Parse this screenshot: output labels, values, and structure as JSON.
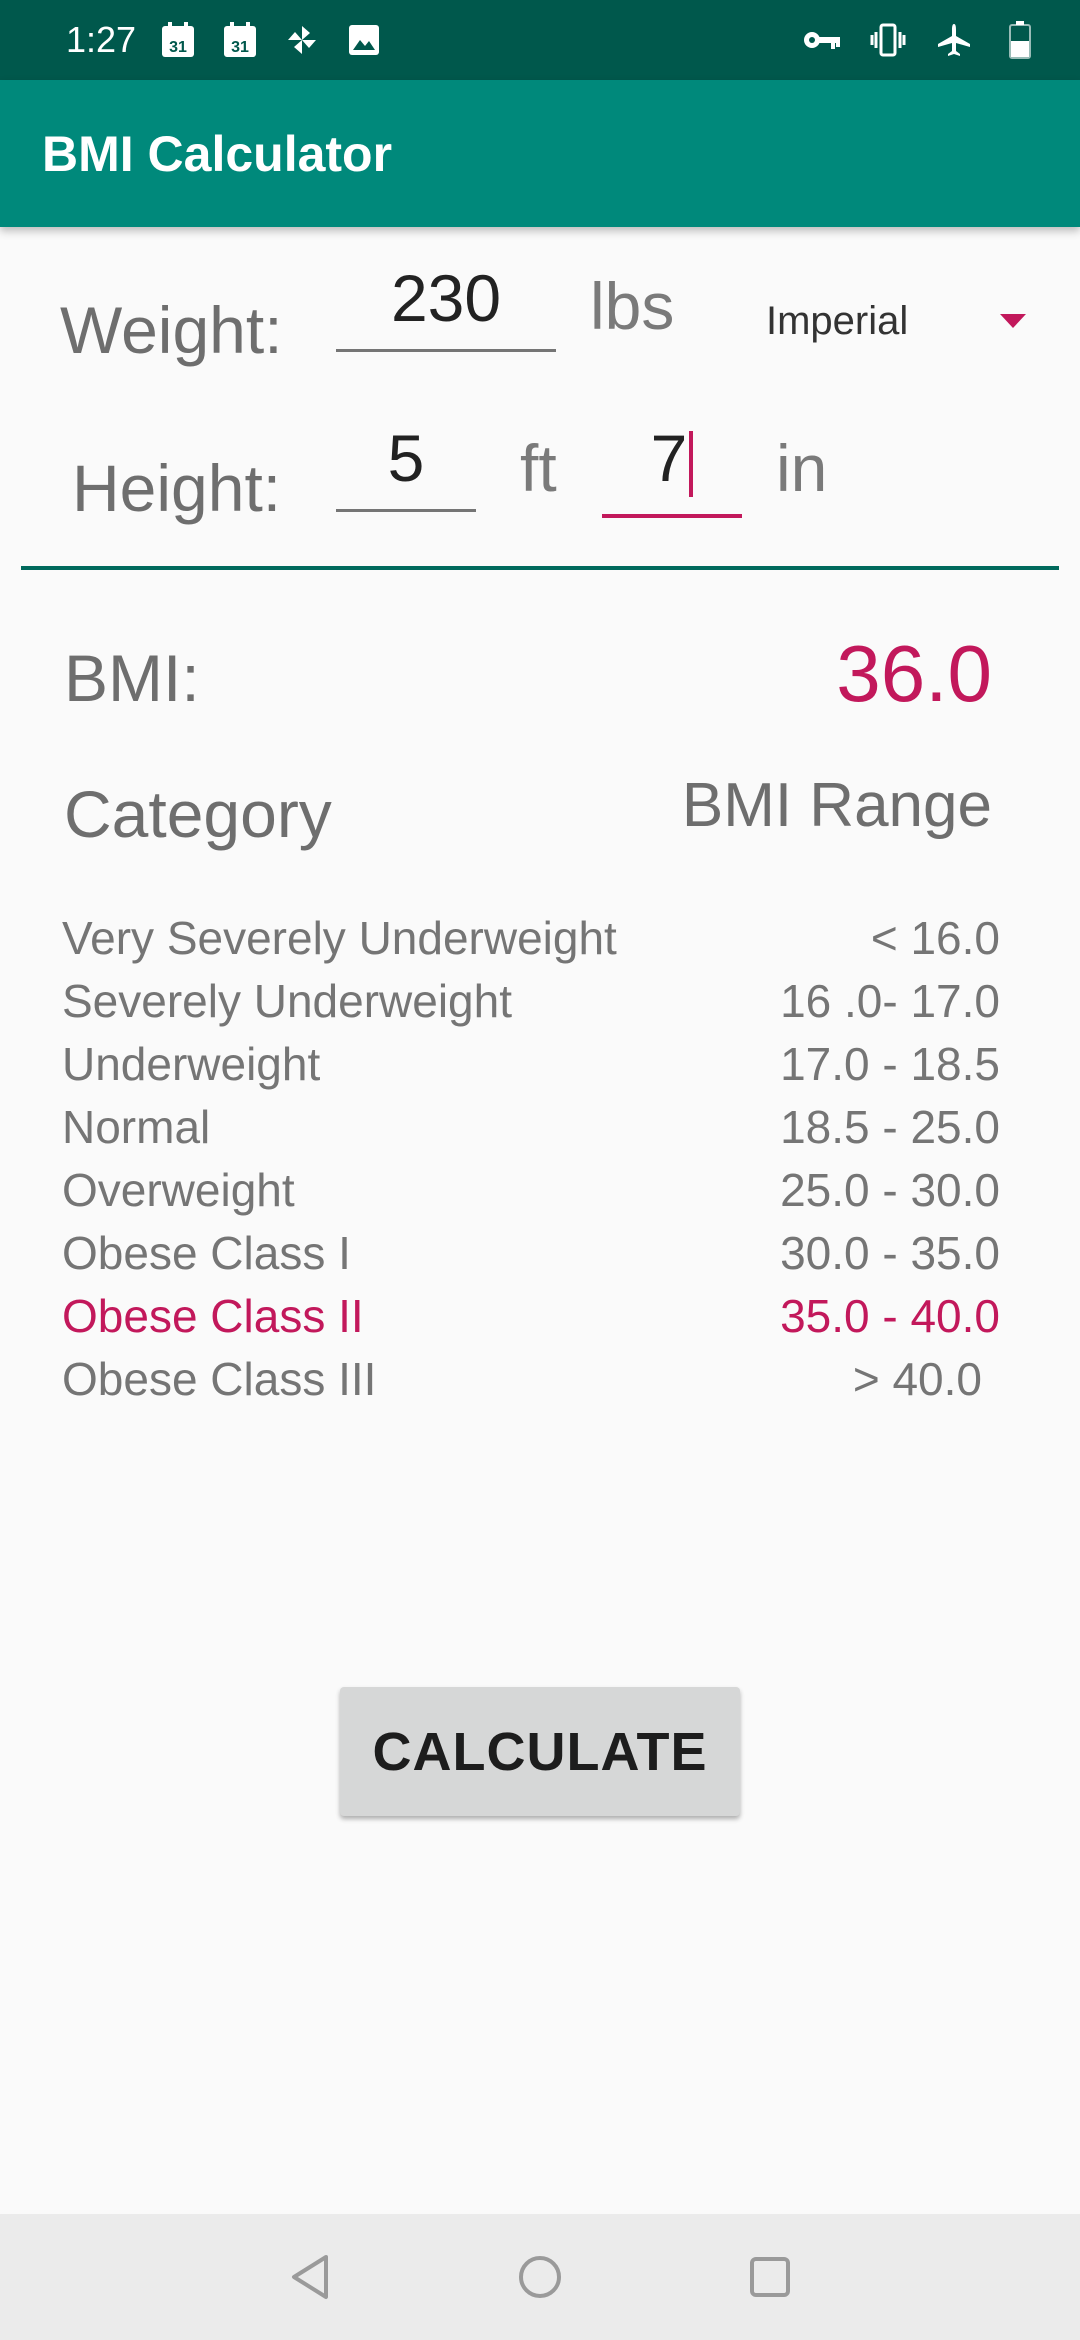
{
  "status_bar": {
    "time": "1:27",
    "calendar_day_1": "31",
    "calendar_day_2": "31",
    "icons": [
      "calendar-icon",
      "calendar-icon",
      "pinwheel-icon",
      "image-icon",
      "key-icon",
      "vibrate-icon",
      "airplane-icon",
      "battery-icon"
    ]
  },
  "app_bar": {
    "title": "BMI Calculator"
  },
  "form": {
    "weight_label": "Weight:",
    "weight_value": "230",
    "weight_unit": "lbs",
    "unit_system": "Imperial",
    "height_label": "Height:",
    "height_ft_value": "5",
    "height_ft_unit": "ft",
    "height_in_value": "7",
    "height_in_unit": "in"
  },
  "result": {
    "bmi_label": "BMI:",
    "bmi_value": "36.0"
  },
  "table": {
    "category_header": "Category",
    "range_header": "BMI Range",
    "rows": [
      {
        "category": "Very Severely Underweight",
        "range": "< 16.0"
      },
      {
        "category": "Severely Underweight",
        "range": "16 .0- 17.0"
      },
      {
        "category": "Underweight",
        "range": "17.0 - 18.5"
      },
      {
        "category": "Normal",
        "range": "18.5 - 25.0"
      },
      {
        "category": "Overweight",
        "range": "25.0 - 30.0"
      },
      {
        "category": "Obese Class I",
        "range": "30.0 - 35.0"
      },
      {
        "category": "Obese Class II",
        "range": "35.0 - 40.0"
      },
      {
        "category": "Obese Class III",
        "range": "> 40.0"
      }
    ],
    "highlighted_row": 6
  },
  "calculate_button": "CALCULATE",
  "colors": {
    "primary": "#00897b",
    "primary_dark": "#00584c",
    "accent": "#c2185b"
  }
}
